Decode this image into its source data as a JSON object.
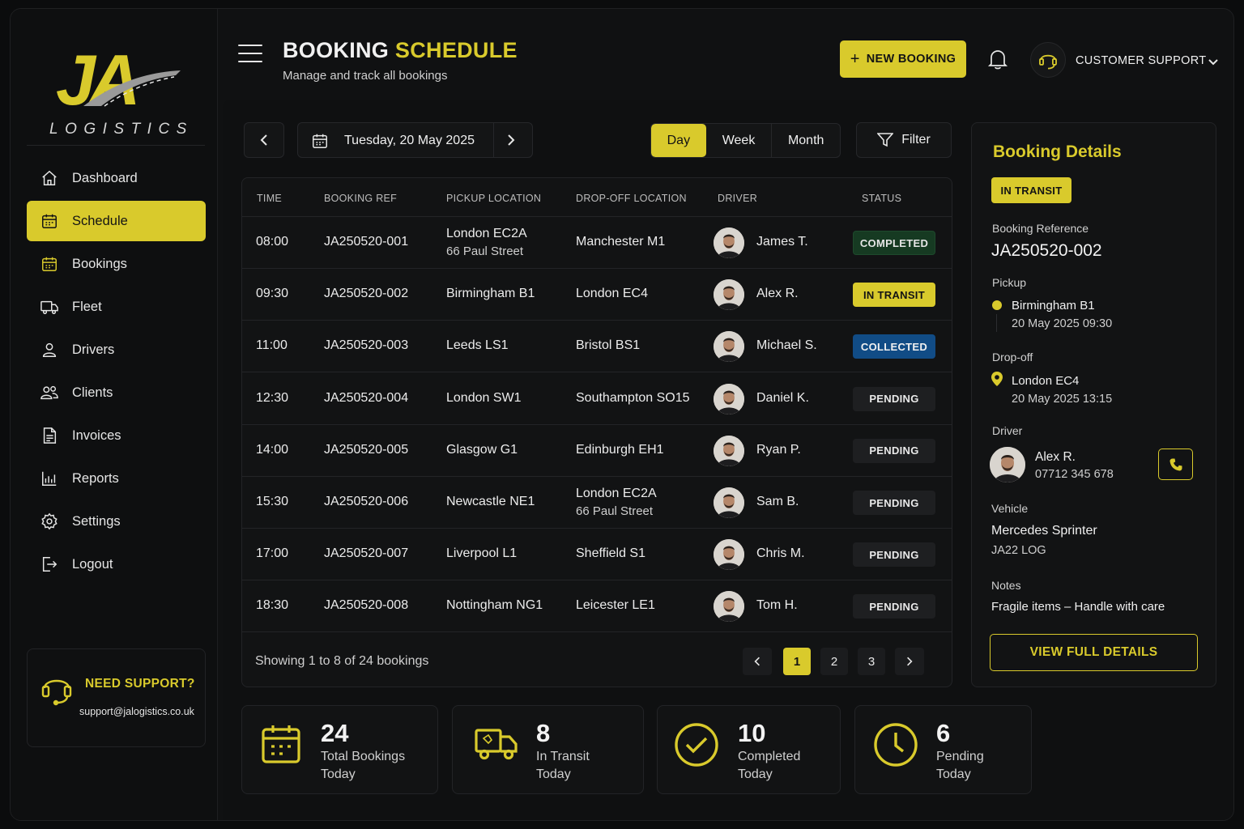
{
  "brand": {
    "logo_initials": "JA",
    "logo_word": "LOGISTICS",
    "accent": "#d9ca2c"
  },
  "sidebar": {
    "items": [
      {
        "label": "Dashboard",
        "icon": "home-icon",
        "active": false
      },
      {
        "label": "Schedule",
        "icon": "calendar-icon",
        "active": true
      },
      {
        "label": "Bookings",
        "icon": "calendar-icon",
        "active": false
      },
      {
        "label": "Fleet",
        "icon": "truck-icon",
        "active": false
      },
      {
        "label": "Drivers",
        "icon": "user-icon",
        "active": false
      },
      {
        "label": "Clients",
        "icon": "users-icon",
        "active": false
      },
      {
        "label": "Invoices",
        "icon": "document-icon",
        "active": false
      },
      {
        "label": "Reports",
        "icon": "chart-icon",
        "active": false
      },
      {
        "label": "Settings",
        "icon": "gear-icon",
        "active": false
      },
      {
        "label": "Logout",
        "icon": "logout-icon",
        "active": false
      }
    ],
    "support": {
      "title": "NEED SUPPORT?",
      "email": "support@jalogistics.co.uk",
      "icon": "headset-icon"
    }
  },
  "header": {
    "title_main": "BOOKING",
    "title_accent": "SCHEDULE",
    "subtitle": "Manage and track all bookings",
    "new_booking_label": "NEW BOOKING",
    "support_label": "CUSTOMER SUPPORT"
  },
  "toolbar": {
    "date": "Tuesday, 20 May 2025",
    "views": [
      "Day",
      "Week",
      "Month"
    ],
    "active_view": "Day",
    "filter_label": "Filter"
  },
  "table": {
    "headers": [
      "TIME",
      "BOOKING REF",
      "PICKUP LOCATION",
      "DROP-OFF LOCATION",
      "DRIVER",
      "STATUS"
    ],
    "rows": [
      {
        "time": "08:00",
        "ref": "JA250520-001",
        "pickup": "London EC2A",
        "pickup2": "66 Paul Street",
        "dropoff": "Manchester M1",
        "dropoff2": "",
        "driver": "James T.",
        "status": "COMPLETED",
        "status_class": "b-completed"
      },
      {
        "time": "09:30",
        "ref": "JA250520-002",
        "pickup": "Birmingham B1",
        "pickup2": "",
        "dropoff": "London EC4",
        "dropoff2": "",
        "driver": "Alex R.",
        "status": "IN TRANSIT",
        "status_class": "b-transit"
      },
      {
        "time": "11:00",
        "ref": "JA250520-003",
        "pickup": "Leeds LS1",
        "pickup2": "",
        "dropoff": "Bristol BS1",
        "dropoff2": "",
        "driver": "Michael S.",
        "status": "COLLECTED",
        "status_class": "b-collected"
      },
      {
        "time": "12:30",
        "ref": "JA250520-004",
        "pickup": "London SW1",
        "pickup2": "",
        "dropoff": "Southampton SO15",
        "dropoff2": "",
        "driver": "Daniel K.",
        "status": "PENDING",
        "status_class": "b-pending"
      },
      {
        "time": "14:00",
        "ref": "JA250520-005",
        "pickup": "Glasgow G1",
        "pickup2": "",
        "dropoff": "Edinburgh EH1",
        "dropoff2": "",
        "driver": "Ryan P.",
        "status": "PENDING",
        "status_class": "b-pending"
      },
      {
        "time": "15:30",
        "ref": "JA250520-006",
        "pickup": "Newcastle NE1",
        "pickup2": "",
        "dropoff": "London EC2A",
        "dropoff2": "66 Paul Street",
        "driver": "Sam B.",
        "status": "PENDING",
        "status_class": "b-pending"
      },
      {
        "time": "17:00",
        "ref": "JA250520-007",
        "pickup": "Liverpool L1",
        "pickup2": "",
        "dropoff": "Sheffield S1",
        "dropoff2": "",
        "driver": "Chris M.",
        "status": "PENDING",
        "status_class": "b-pending"
      },
      {
        "time": "18:30",
        "ref": "JA250520-008",
        "pickup": "Nottingham NG1",
        "pickup2": "",
        "dropoff": "Leicester LE1",
        "dropoff2": "",
        "driver": "Tom H.",
        "status": "PENDING",
        "status_class": "b-pending"
      }
    ],
    "footer_info": "Showing 1 to 8 of 24 bookings",
    "pages": [
      "1",
      "2",
      "3"
    ],
    "current_page": "1"
  },
  "details": {
    "title": "Booking Details",
    "status": "IN TRANSIT",
    "ref_label": "Booking Reference",
    "ref": "JA250520-002",
    "pickup_label": "Pickup",
    "pickup": "Birmingham B1",
    "pickup_time": "20 May 2025 09:30",
    "dropoff_label": "Drop-off",
    "dropoff": "London EC4",
    "dropoff_time": "20 May 2025 13:15",
    "driver_label": "Driver",
    "driver": "Alex R.",
    "driver_phone": "07712 345 678",
    "vehicle_label": "Vehicle",
    "vehicle": "Mercedes Sprinter",
    "vehicle_reg": "JA22 LOG",
    "notes_label": "Notes",
    "notes": "Fragile items – Handle with care",
    "view_button": "VIEW FULL DETAILS"
  },
  "stats": [
    {
      "value": "24",
      "line1": "Total Bookings",
      "line2": "Today",
      "icon": "calendar-icon"
    },
    {
      "value": "8",
      "line1": "In Transit",
      "line2": "Today",
      "icon": "truck-icon"
    },
    {
      "value": "10",
      "line1": "Completed",
      "line2": "Today",
      "icon": "check-circle-icon"
    },
    {
      "value": "6",
      "line1": "Pending",
      "line2": "Today",
      "icon": "clock-icon"
    }
  ]
}
